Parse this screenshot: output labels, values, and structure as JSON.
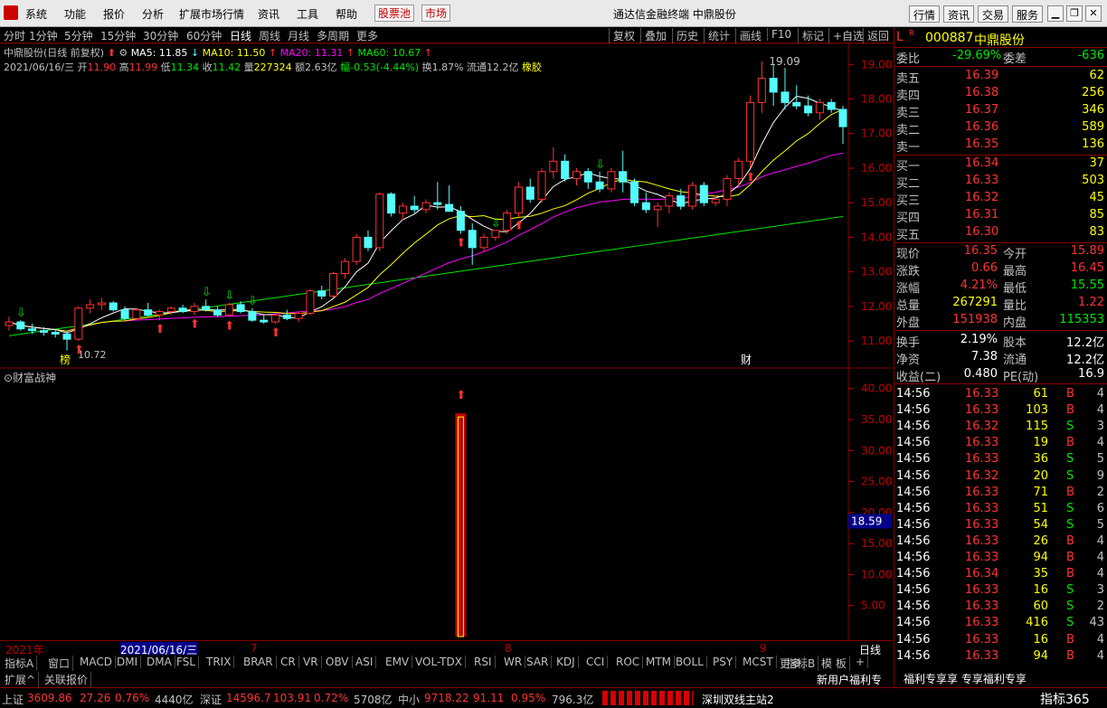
{
  "menu": {
    "items": [
      "系统",
      "功能",
      "报价",
      "分析",
      "扩展市场行情",
      "资讯",
      "工具",
      "帮助"
    ],
    "pool": "股票池",
    "market": "市场",
    "title": "通达信金融终端  中鼎股份",
    "rbtns": [
      "行情",
      "资讯",
      "交易",
      "服务"
    ]
  },
  "periods": {
    "items": [
      "分时",
      "1分钟",
      "5分钟",
      "15分钟",
      "30分钟",
      "60分钟",
      "日线",
      "周线",
      "月线",
      "多周期",
      "更多"
    ],
    "selected": "日线"
  },
  "toolbar": [
    "复权",
    "叠加",
    "历史",
    "统计",
    "画线",
    "F10",
    "标记",
    "+自选",
    "返回"
  ],
  "stock_header": {
    "name": "中鼎股份(日线 前复权)",
    "ma5": "MA5: 11.85",
    "ma10": "MA10: 11.50",
    "ma20": "MA20: 11.31",
    "ma60": "MA60: 10.67"
  },
  "info_line": {
    "date": "2021/06/16/三",
    "open_l": "开",
    "open": "11.90",
    "high_l": "高",
    "high": "11.99",
    "low_l": "低",
    "low": "11.34",
    "close_l": "收",
    "close": "11.42",
    "vol_l": "量",
    "vol": "227324",
    "amt": "额2.63亿",
    "chg": "幅-0.53(-4.44%)",
    "turn": "换1.87%",
    "float": "流通12.2亿",
    "sector": "橡胶"
  },
  "chart_data": {
    "type": "candlestick",
    "y_ticks": [
      "19.00",
      "18.00",
      "17.00",
      "16.00",
      "15.00",
      "14.00",
      "13.00",
      "12.00",
      "11.00"
    ],
    "ylim": [
      10.4,
      19.4
    ],
    "max_label": "19.09",
    "min_label": "10.72",
    "ma_colors": {
      "ma5": "#ffffff",
      "ma10": "#ffff00",
      "ma20": "#ff00ff",
      "ma60": "#00e600"
    },
    "caifu_label": "财",
    "bang_label": "榜"
  },
  "sub_chart": {
    "name": "财富战神",
    "y_ticks": [
      "40.00",
      "35.00",
      "30.00",
      "25.00",
      "20.00",
      "15.00",
      "10.00",
      "5.00"
    ],
    "current": "18.59",
    "ylim": [
      0,
      42
    ]
  },
  "date_axis": {
    "labels": [
      "2021年",
      "2021/06/16/三",
      "7",
      "8",
      "9"
    ],
    "right": "日线"
  },
  "tabs": [
    "指标A",
    "窗口",
    "MACD",
    "DMI",
    "DMA",
    "FSL",
    "TRIX",
    "BRAR",
    "CR",
    "VR",
    "OBV",
    "ASI",
    "EMV",
    "VOL-TDX",
    "RSI",
    "WR",
    "SAR",
    "KDJ",
    "CCI",
    "ROC",
    "MTM",
    "BOLL",
    "PSY",
    "MCST",
    "更多"
  ],
  "tabs_right": [
    "指标B",
    "模 板",
    "+"
  ],
  "tabs2": [
    "扩展^",
    "关联报价"
  ],
  "ad": "新用户福利专享",
  "quote": {
    "code": "000887",
    "name": "中鼎股份",
    "weibi_l": "委比",
    "weibi": "-29.69%",
    "weicha_l": "委差",
    "weicha": "-636",
    "asks": [
      {
        "l": "卖五",
        "p": "16.39",
        "v": "62"
      },
      {
        "l": "卖四",
        "p": "16.38",
        "v": "256"
      },
      {
        "l": "卖三",
        "p": "16.37",
        "v": "346"
      },
      {
        "l": "卖二",
        "p": "16.36",
        "v": "589"
      },
      {
        "l": "卖一",
        "p": "16.35",
        "v": "136"
      }
    ],
    "bids": [
      {
        "l": "买一",
        "p": "16.34",
        "v": "37"
      },
      {
        "l": "买二",
        "p": "16.33",
        "v": "503"
      },
      {
        "l": "买三",
        "p": "16.32",
        "v": "45"
      },
      {
        "l": "买四",
        "p": "16.31",
        "v": "85"
      },
      {
        "l": "买五",
        "p": "16.30",
        "v": "83"
      }
    ],
    "stats": [
      {
        "l1": "现价",
        "v1": "16.35",
        "l2": "今开",
        "v2": "15.89"
      },
      {
        "l1": "涨跌",
        "v1": "0.66",
        "l2": "最高",
        "v2": "16.45"
      },
      {
        "l1": "涨幅",
        "v1": "4.21%",
        "l2": "最低",
        "v2": "15.55"
      },
      {
        "l1": "总量",
        "v1": "267291",
        "l2": "量比",
        "v2": "1.22"
      },
      {
        "l1": "外盘",
        "v1": "151938",
        "l2": "内盘",
        "v2": "115353"
      }
    ],
    "stats2": [
      {
        "l1": "换手",
        "v1": "2.19%",
        "l2": "股本",
        "v2": "12.2亿"
      },
      {
        "l1": "净资",
        "v1": "7.38",
        "l2": "流通",
        "v2": "12.2亿"
      },
      {
        "l1": "收益(二)",
        "v1": "0.480",
        "l2": "PE(动)",
        "v2": "16.9"
      }
    ]
  },
  "ticks": [
    {
      "t": "14:56",
      "p": "16.33",
      "v": "61",
      "d": "B",
      "n": "4"
    },
    {
      "t": "14:56",
      "p": "16.33",
      "v": "103",
      "d": "B",
      "n": "4"
    },
    {
      "t": "14:56",
      "p": "16.32",
      "v": "115",
      "d": "S",
      "n": "3"
    },
    {
      "t": "14:56",
      "p": "16.33",
      "v": "19",
      "d": "B",
      "n": "4"
    },
    {
      "t": "14:56",
      "p": "16.33",
      "v": "36",
      "d": "S",
      "n": "5"
    },
    {
      "t": "14:56",
      "p": "16.32",
      "v": "20",
      "d": "S",
      "n": "9"
    },
    {
      "t": "14:56",
      "p": "16.33",
      "v": "71",
      "d": "B",
      "n": "2"
    },
    {
      "t": "14:56",
      "p": "16.33",
      "v": "51",
      "d": "S",
      "n": "6"
    },
    {
      "t": "14:56",
      "p": "16.33",
      "v": "54",
      "d": "S",
      "n": "5"
    },
    {
      "t": "14:56",
      "p": "16.33",
      "v": "26",
      "d": "B",
      "n": "4"
    },
    {
      "t": "14:56",
      "p": "16.33",
      "v": "94",
      "d": "B",
      "n": "4"
    },
    {
      "t": "14:56",
      "p": "16.34",
      "v": "35",
      "d": "B",
      "n": "4"
    },
    {
      "t": "14:56",
      "p": "16.33",
      "v": "16",
      "d": "S",
      "n": "3"
    },
    {
      "t": "14:56",
      "p": "16.33",
      "v": "60",
      "d": "S",
      "n": "2"
    },
    {
      "t": "14:56",
      "p": "16.33",
      "v": "416",
      "d": "S",
      "n": "43"
    },
    {
      "t": "14:56",
      "p": "16.33",
      "v": "16",
      "d": "B",
      "n": "4"
    },
    {
      "t": "14:56",
      "p": "16.33",
      "v": "94",
      "d": "B",
      "n": "4"
    }
  ],
  "tick_banner": "福利专享享  专享福利专享",
  "status": {
    "sh_l": "上证",
    "sh": "3609.86",
    "sh_c": "27.26",
    "sh_p": "0.76%",
    "sh_a": "4440亿",
    "sz_l": "深证",
    "sz": "14596.7",
    "sz_c": "103.91",
    "sz_p": "0.72%",
    "sz_a": "5708亿",
    "zx_l": "中小",
    "zx": "9718.22",
    "zx_c": "91.11",
    "zx_p": "0.95%",
    "zx_a": "796.3亿",
    "conn": "深圳双线主站2",
    "logo": "指标365"
  }
}
